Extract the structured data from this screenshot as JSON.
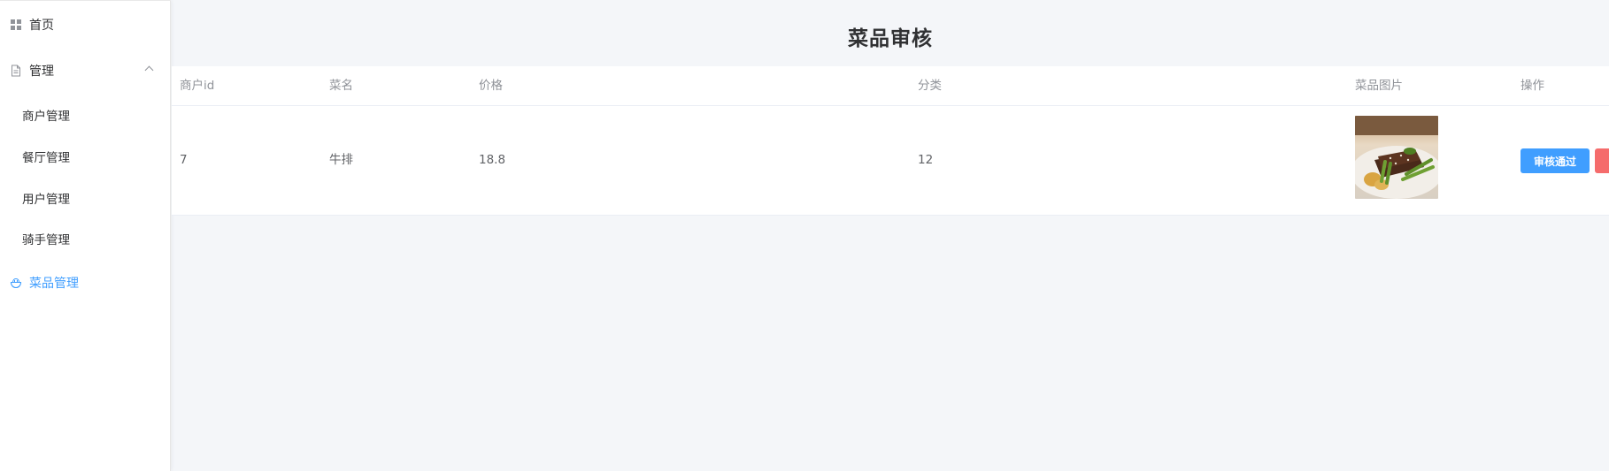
{
  "sidebar": {
    "home": {
      "label": "首页",
      "icon": "grid-icon"
    },
    "manage": {
      "label": "管理",
      "icon": "document-icon",
      "expanded": true,
      "children": [
        {
          "label": "商户管理"
        },
        {
          "label": "餐厅管理"
        },
        {
          "label": "用户管理"
        },
        {
          "label": "骑手管理"
        }
      ]
    },
    "dish": {
      "label": "菜品管理",
      "icon": "bowl-icon",
      "active": true
    }
  },
  "main": {
    "title": "菜品审核",
    "table": {
      "columns": [
        "商户id",
        "菜名",
        "价格",
        "分类",
        "菜品图片",
        "操作"
      ],
      "rows": [
        {
          "merchant_id": "7",
          "name": "牛排",
          "price": "18.8",
          "category": "12",
          "image": "steak-dish-photo",
          "actions": {
            "approve": "审核通过"
          }
        }
      ]
    }
  },
  "colors": {
    "accent": "#409eff",
    "danger": "#f56c6c",
    "background": "#f4f6f9"
  }
}
